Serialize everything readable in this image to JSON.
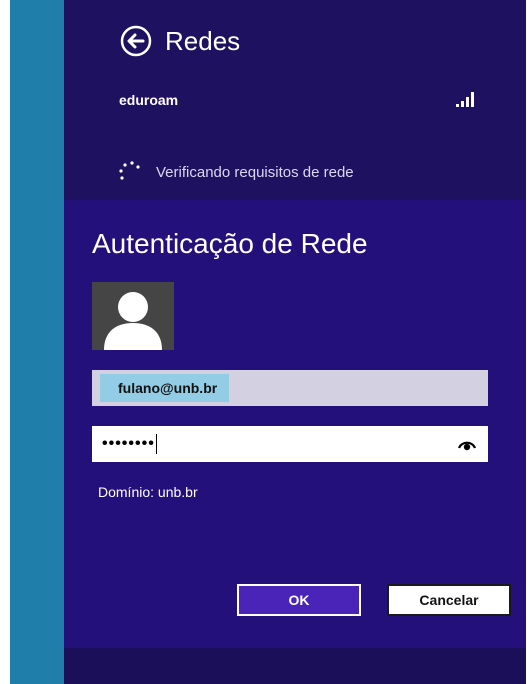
{
  "header": {
    "back_icon": "back-arrow-icon",
    "title": "Redes",
    "network_name": "eduroam",
    "signal_icon": "signal-strength-icon",
    "status_icon": "spinner-icon",
    "status_text": "Verificando requisitos de rede"
  },
  "auth": {
    "title": "Autenticação de Rede",
    "avatar_icon": "user-avatar-icon",
    "username": "fulano@unb.br",
    "password_mask": "••••••••",
    "reveal_icon": "eye-reveal-icon",
    "domain": "Domínio: unb.br",
    "ok_label": "OK",
    "cancel_label": "Cancelar"
  },
  "colors": {
    "accent_strip": "#1f7faa",
    "header_bg": "#1e1260",
    "panel_bg": "#24107a",
    "ok_button": "#4a23b8",
    "username_highlight": "#93cde5"
  }
}
